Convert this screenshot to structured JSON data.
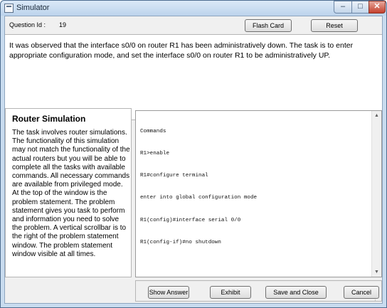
{
  "window": {
    "title": "Simulator",
    "minimize_glyph": "–",
    "maximize_glyph": "□",
    "close_glyph": "✕"
  },
  "header": {
    "question_id_label": "Question Id :",
    "question_id_value": "19",
    "flash_card_label": "Flash Card",
    "reset_label": "Reset"
  },
  "question": {
    "text": "It was observed that the interface s0/0 on router R1 has been administratively down. The task is to enter appropriate configuration mode, and set the interface s0/0 on router R1 to be administratively UP."
  },
  "info_panel": {
    "heading": "Router Simulation",
    "body": "The task involves router simulations. The functionality of this simulation may not match the functionality of the actual routers but you will be able to complete all the tasks with available commands. All necessary commands are available from privileged mode. At the top of the window is the problem statement. The problem statement gives you task to perform and information you need to solve the problem. A vertical scrollbar is to the right of the problem statement window. The problem statement window visible at all times."
  },
  "console": {
    "lines": [
      "Commands",
      "R1>enable",
      "R1#configure terminal",
      "enter into global configuration mode",
      "R1(config)#interface serial 0/0",
      "R1(config-if)#no shutdown"
    ],
    "scroll_up_glyph": "▲",
    "scroll_down_glyph": "▼"
  },
  "footer": {
    "show_answer_label": "Show Answer",
    "exhibit_label": "Exhibit",
    "save_close_label": "Save and Close",
    "cancel_label": "Cancel"
  },
  "colors": {
    "titlebar": "#c9dcef",
    "client_bg": "#f0f0f0",
    "panel_bg": "#ffffff",
    "close_button": "#c4402d"
  }
}
